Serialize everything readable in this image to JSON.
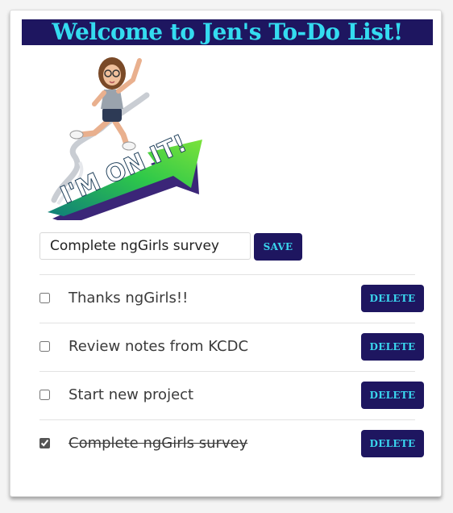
{
  "app": {
    "title": "Welcome to Jen's To-Do List!"
  },
  "hero": {
    "banner_text": "I'M ON IT!",
    "icon": "bitmoji-im-on-it-image"
  },
  "new_todo": {
    "value": "Complete ngGirls survey",
    "save_label": "SAVE"
  },
  "todos": [
    {
      "text": "Thanks ngGirls!!",
      "checked": false,
      "delete_label": "DELETE"
    },
    {
      "text": "Review notes from KCDC",
      "checked": false,
      "delete_label": "DELETE"
    },
    {
      "text": "Start new project",
      "checked": false,
      "delete_label": "DELETE"
    },
    {
      "text": "Complete ngGirls survey",
      "checked": true,
      "delete_label": "DELETE"
    }
  ],
  "colors": {
    "accent_bg": "#1e1660",
    "accent_text": "#34dcf0",
    "arrow_green": "#2ec84a",
    "arrow_purple": "#4a2d8f"
  }
}
